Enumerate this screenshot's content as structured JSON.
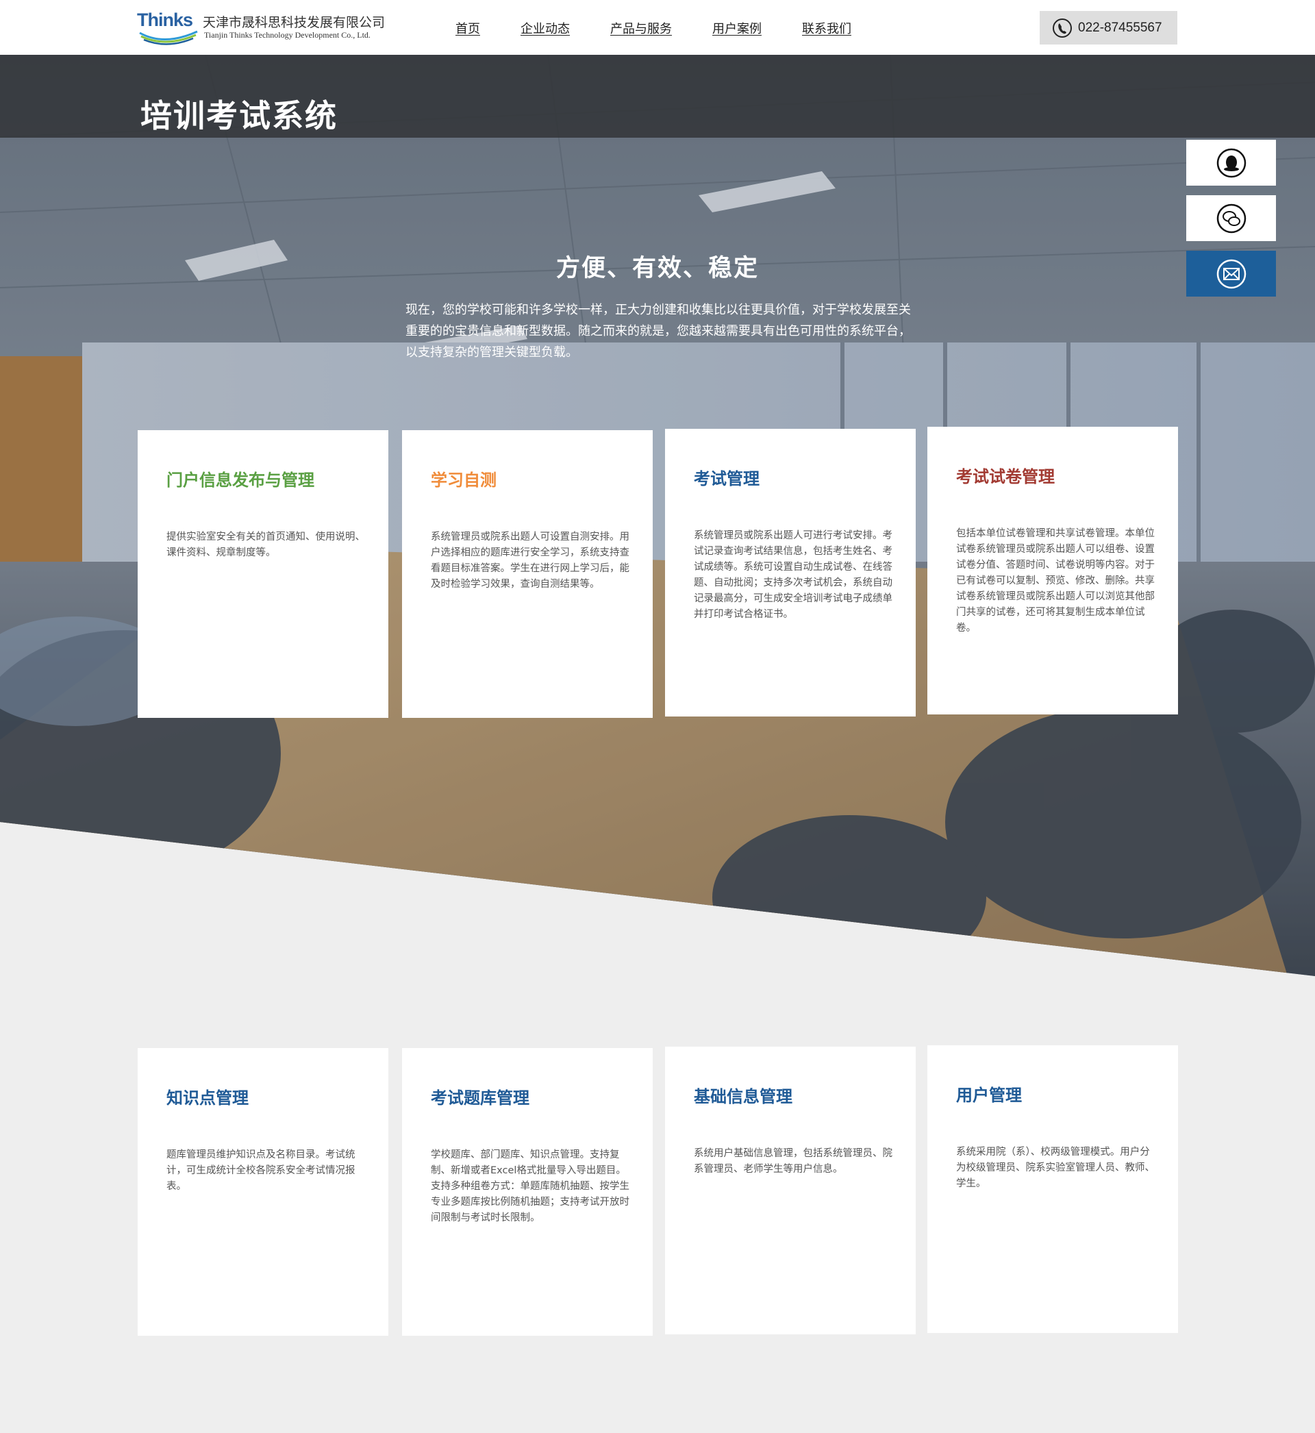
{
  "header": {
    "logo_mark": "Thinks",
    "company_cn": "天津市晟科思科技发展有限公司",
    "company_en": "Tianjin Thinks Technology Development Co., Ltd.",
    "nav": [
      "首页",
      "企业动态",
      "产品与服务",
      "用户案例",
      "联系我们"
    ],
    "phone_icon": "phone-icon",
    "phone": "022-87455567"
  },
  "hero": {
    "title": "培训考试系统",
    "slogan": "方便、有效、稳定",
    "intro": "现在，您的学校可能和许多学校一样，正大力创建和收集比以往更具价值，对于学校发展至关重要的的宝贵信息和新型数据。随之而来的就是，您越来越需要具有出色可用性的系统平台，以支持复杂的管理关键型负载。"
  },
  "side_buttons": [
    {
      "icon": "qq-icon"
    },
    {
      "icon": "wechat-icon"
    },
    {
      "icon": "mail-icon"
    }
  ],
  "features_top": [
    {
      "title": "门户信息发布与管理",
      "color": "#5aa043",
      "text": "提供实验室安全有关的首页通知、使用说明、课件资料、规章制度等。"
    },
    {
      "title": "学习自测",
      "color": "#f08c3a",
      "text": "系统管理员或院系出题人可设置自测安排。用户选择相应的题库进行安全学习，系统支持查看题目标准答案。学生在进行网上学习后，能及时检验学习效果，查询自测结果等。"
    },
    {
      "title": "考试管理",
      "color": "#1f5a96",
      "text": "系统管理员或院系出题人可进行考试安排。考试记录查询考试结果信息，包括考生姓名、考试成绩等。系统可设置自动生成试卷、在线答题、自动批阅；支持多次考试机会，系统自动记录最高分，可生成安全培训考试电子成绩单并打印考试合格证书。"
    },
    {
      "title": "考试试卷管理",
      "color": "#a23a32",
      "text": "包括本单位试卷管理和共享试卷管理。本单位试卷系统管理员或院系出题人可以组卷、设置试卷分值、答题时间、试卷说明等内容。对于已有试卷可以复制、预览、修改、删除。共享试卷系统管理员或院系出题人可以浏览其他部门共享的试卷，还可将其复制生成本单位试卷。"
    }
  ],
  "features_bottom": [
    {
      "title": "知识点管理",
      "color": "#1f5a96",
      "text": "题库管理员维护知识点及名称目录。考试统计，可生成统计全校各院系安全考试情况报表。"
    },
    {
      "title": "考试题库管理",
      "color": "#1f5a96",
      "text": "学校题库、部门题库、知识点管理。支持复制、新增或者Excel格式批量导入导出题目。支持多种组卷方式：单题库随机抽题、按学生专业多题库按比例随机抽题；支持考试开放时间限制与考试时长限制。"
    },
    {
      "title": "基础信息管理",
      "color": "#1f5a96",
      "text": "系统用户基础信息管理，包括系统管理员、院系管理员、老师学生等用户信息。"
    },
    {
      "title": "用户管理",
      "color": "#1f5a96",
      "text": "系统采用院（系）、校两级管理模式。用户分为校级管理员、院系实验室管理人员、教师、学生。"
    }
  ]
}
